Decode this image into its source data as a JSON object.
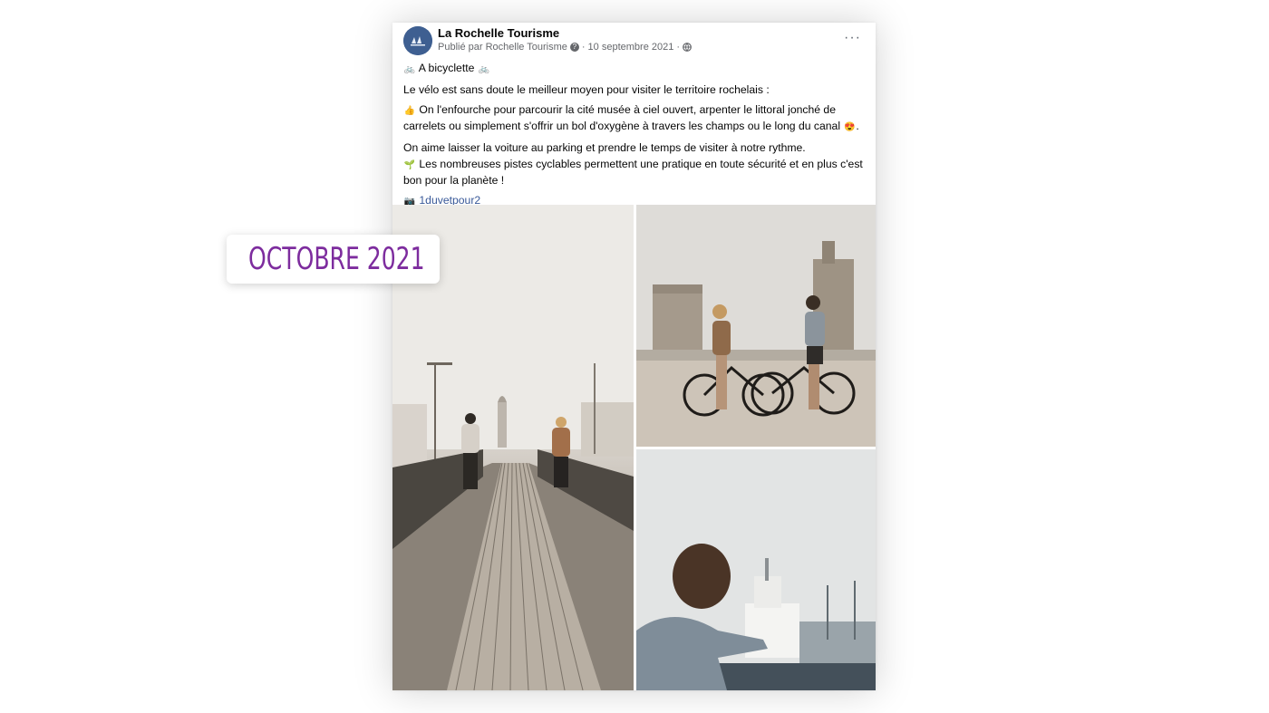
{
  "post": {
    "page_name": "La Rochelle Tourisme",
    "published_by": "Publié par Rochelle Tourisme",
    "date": "10 septembre 2021",
    "more_label": "···",
    "title_line": "A bicyclette",
    "line1": "Le vélo est sans doute le meilleur moyen pour visiter le territoire rochelais :",
    "line2": "On l'enfourche pour parcourir la cité musée à ciel ouvert, arpenter le littoral jonché de carrelets ou simplement s'offrir un bol d'oxygène à travers les champs ou le long du canal",
    "line2_end": ".",
    "line3": "On aime laisser la voiture au parking et prendre le temps de visiter à notre rythme.",
    "line4": "Les nombreuses pistes cyclables permettent une pratique en toute sécurité et en plus c'est bon pour la planète !",
    "credit": "1duvetpour2",
    "icons": {
      "bike": "🚲",
      "thumb": "👍",
      "heart_eyes": "😍",
      "sprout": "🌱",
      "camera": "📷"
    }
  },
  "tag": {
    "text": "OCTOBRE 2021",
    "color": "#7d2c9e",
    "icon": "location-pin-icon"
  }
}
